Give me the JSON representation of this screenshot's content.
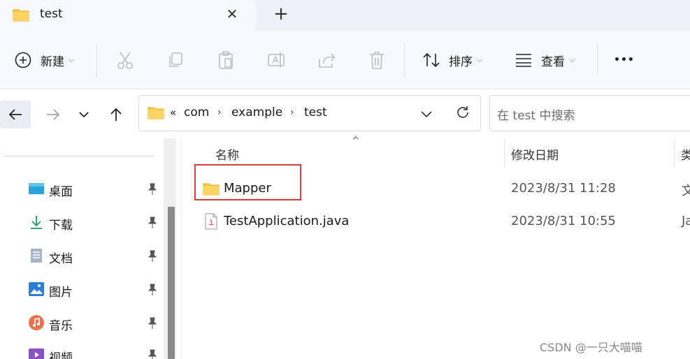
{
  "tab": {
    "title": "test",
    "close_glyph": "✕",
    "new_tab_glyph": "+"
  },
  "commandbar": {
    "new_label": "新建",
    "sort_label": "排序",
    "view_label": "查看",
    "more_glyph": "•••",
    "caret": "⌵"
  },
  "address": {
    "overflow_glyph": "«",
    "crumbs": [
      "com",
      "example",
      "test"
    ],
    "crumb_sep": "›",
    "search_placeholder": "在 test 中搜索"
  },
  "navpane": {
    "items": [
      {
        "label": "桌面",
        "icon": "desktop-icon"
      },
      {
        "label": "下载",
        "icon": "download-icon"
      },
      {
        "label": "文档",
        "icon": "document-icon"
      },
      {
        "label": "图片",
        "icon": "pictures-icon"
      },
      {
        "label": "音乐",
        "icon": "music-icon"
      },
      {
        "label": "视频",
        "icon": "video-icon"
      }
    ]
  },
  "filelist": {
    "columns": {
      "name": "名称",
      "date": "修改日期",
      "type": "类"
    },
    "sort_glyph": "^",
    "rows": [
      {
        "name": "Mapper",
        "date": "2023/8/31 11:28",
        "type": "文",
        "icon": "folder-icon"
      },
      {
        "name": "TestApplication.java",
        "date": "2023/8/31 10:55",
        "type": "Ja",
        "icon": "java-file-icon"
      }
    ]
  },
  "watermark": "CSDN @一只大喵喵",
  "colors": {
    "folder": "#f7c948",
    "folder_dark": "#e6ad1f",
    "highlight": "#e03a3a",
    "accent": "#0067c0"
  }
}
